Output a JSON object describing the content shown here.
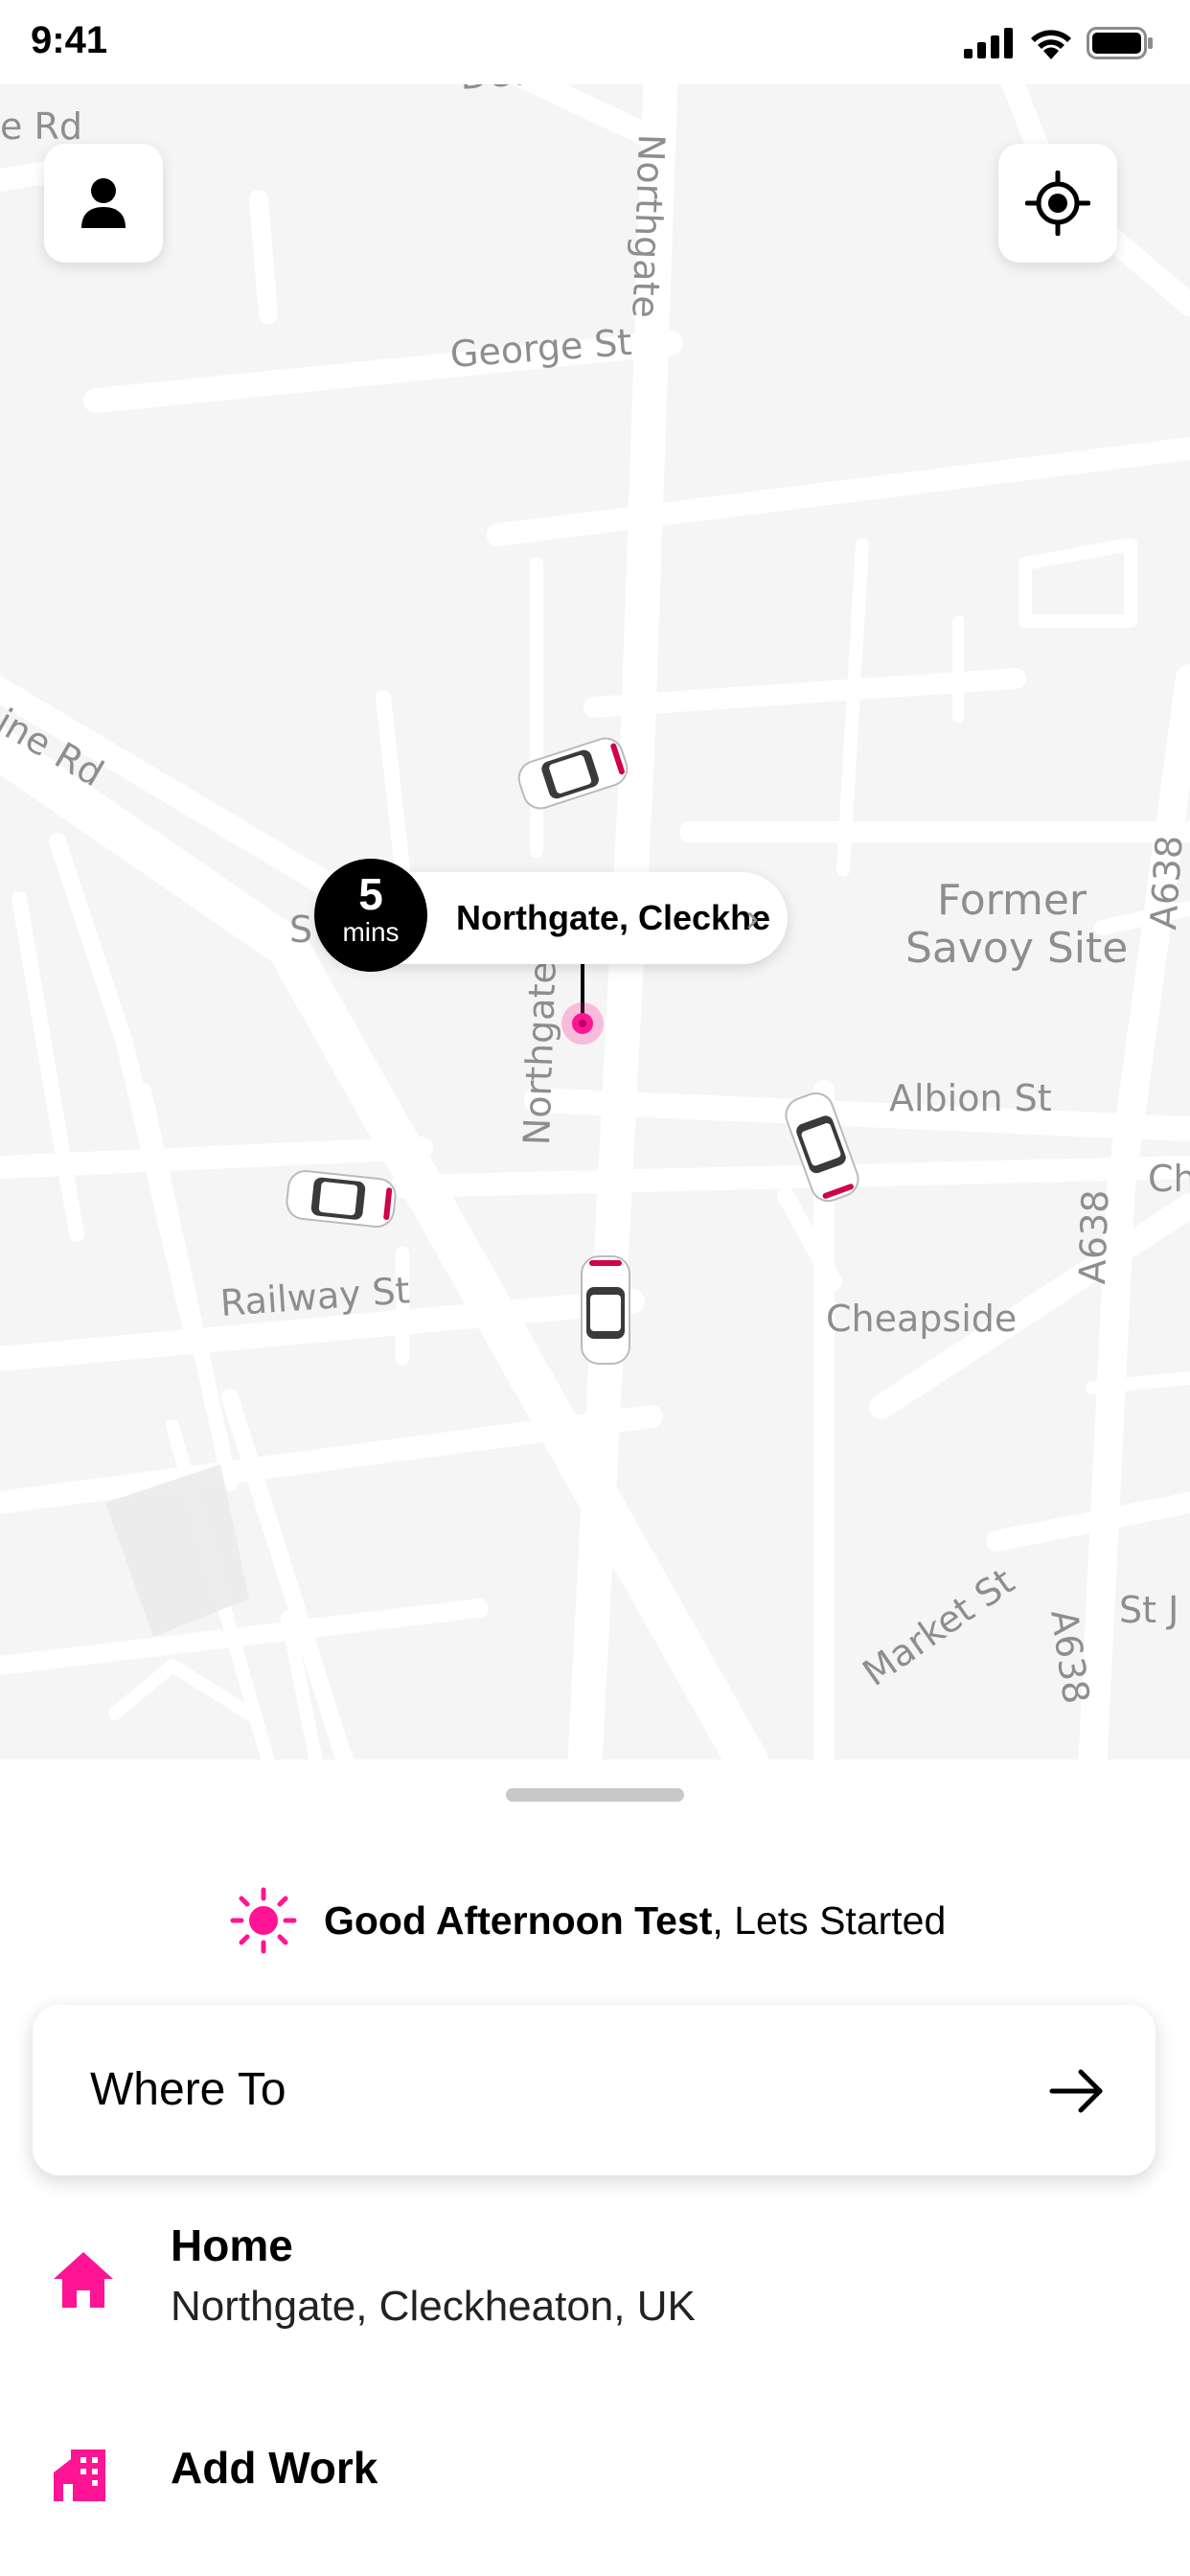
{
  "status": {
    "time": "9:41"
  },
  "map": {
    "labels": {
      "e_rd": "e Rd",
      "dewsbury": "Dewsb",
      "northgate_top": "Northgate",
      "george_st": "George St",
      "ine_rd": "ine Rd",
      "s_fragment": "S",
      "northgate_mid": "Northgate",
      "former": "Former",
      "savoy": "Savoy Site",
      "a638_right": "A638",
      "albion_st": "Albion St",
      "ch_fragment": "Ch",
      "railway_st": "Railway St",
      "cheapside": "Cheapside",
      "a638_mid": "A638",
      "market_st": "Market St",
      "a638_bottom": "A638",
      "st_j": "St J"
    },
    "eta": {
      "number": "5",
      "unit": "mins",
      "location": "Northgate, Cleckhe"
    }
  },
  "sheet": {
    "greeting_bold": "Good Afternoon Test",
    "greeting_rest": ", Lets Started",
    "where_to": "Where To",
    "home": {
      "title": "Home",
      "address": "Northgate, Cleckheaton, UK"
    },
    "work": {
      "title": "Add Work"
    }
  },
  "colors": {
    "accent": "#ff1493",
    "map_bg": "#f5f5f5",
    "road": "#ffffff",
    "label": "#8e8e8e"
  },
  "icons": [
    "signal-icon",
    "wifi-icon",
    "battery-icon",
    "profile-icon",
    "locate-icon",
    "car-icon",
    "pin-icon",
    "sun-icon",
    "arrow-right-icon",
    "home-icon",
    "work-icon"
  ]
}
